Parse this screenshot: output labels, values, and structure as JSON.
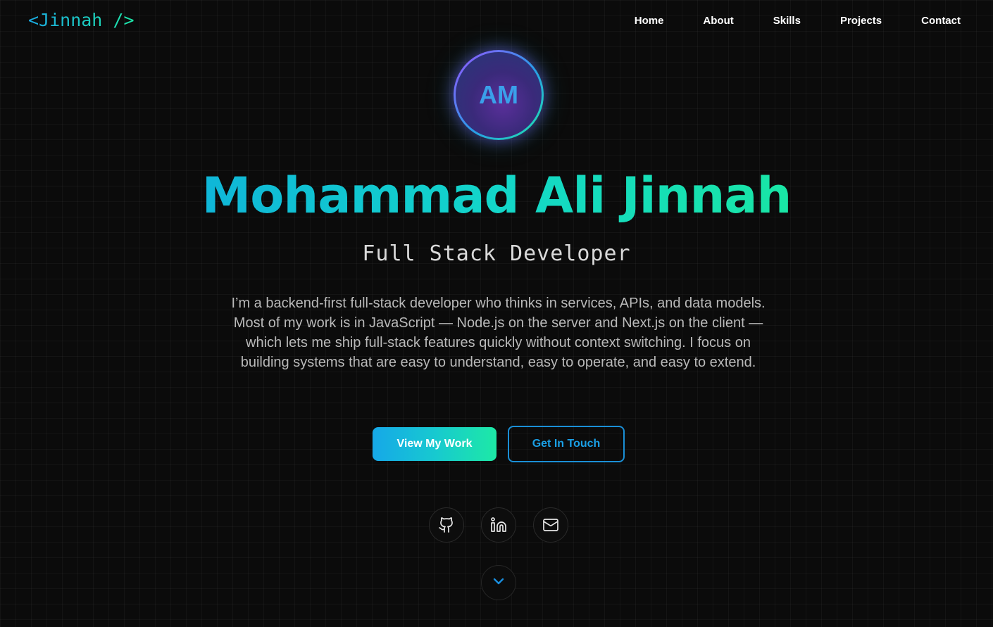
{
  "logo": {
    "text": "<Jinnah />"
  },
  "nav": {
    "items": [
      {
        "label": "Home"
      },
      {
        "label": "About"
      },
      {
        "label": "Skills"
      },
      {
        "label": "Projects"
      },
      {
        "label": "Contact"
      }
    ]
  },
  "avatar": {
    "initials": "AM"
  },
  "hero": {
    "name": "Mohammad Ali Jinnah",
    "role": "Full Stack Developer",
    "bio": "I’m a backend-first full-stack developer who thinks in services, APIs, and data models. Most of my work is in JavaScript — Node.js on the server and Next.js on the client — which lets me ship full-stack features quickly without context switching. I focus on building systems that are easy to understand, easy to operate, and easy to extend."
  },
  "buttons": {
    "primary": "View My Work",
    "secondary": "Get In Touch"
  },
  "social": [
    {
      "icon": "github-icon"
    },
    {
      "icon": "linkedin-icon"
    },
    {
      "icon": "mail-icon"
    }
  ],
  "scroll": {
    "icon": "chevron-down-icon"
  },
  "colors": {
    "background": "#0b0b0b",
    "accent_blue": "#16a8e8",
    "accent_green": "#1de9a6",
    "text": "#ffffff",
    "muted_text": "#b9b9b9"
  }
}
